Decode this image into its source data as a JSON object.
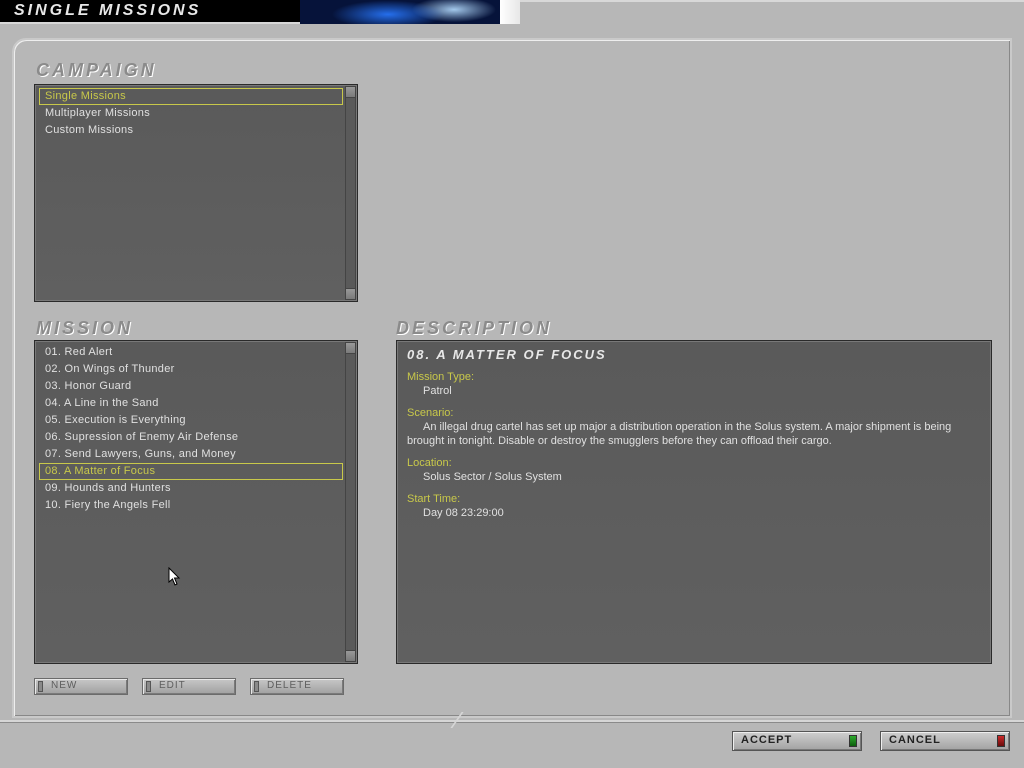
{
  "screen_title": "SINGLE MISSIONS",
  "sections": {
    "campaign": "CAMPAIGN",
    "mission": "MISSION",
    "description": "DESCRIPTION"
  },
  "campaigns": [
    {
      "label": "Single Missions",
      "selected": true
    },
    {
      "label": "Multiplayer Missions",
      "selected": false
    },
    {
      "label": "Custom Missions",
      "selected": false
    }
  ],
  "missions": [
    {
      "label": "01. Red Alert",
      "selected": false
    },
    {
      "label": "02. On Wings of Thunder",
      "selected": false
    },
    {
      "label": "03. Honor Guard",
      "selected": false
    },
    {
      "label": "04. A Line in the Sand",
      "selected": false
    },
    {
      "label": "05. Execution is Everything",
      "selected": false
    },
    {
      "label": "06. Supression of Enemy Air Defense",
      "selected": false
    },
    {
      "label": "07. Send Lawyers, Guns, and Money",
      "selected": false
    },
    {
      "label": "08. A Matter of Focus",
      "selected": true
    },
    {
      "label": "09. Hounds and Hunters",
      "selected": false
    },
    {
      "label": "10. Fiery the Angels Fell",
      "selected": false
    }
  ],
  "mission_buttons": {
    "new": "NEW",
    "edit": "EDIT",
    "delete": "DELETE"
  },
  "description": {
    "title": "08. A MATTER OF FOCUS",
    "type_label": "Mission Type:",
    "type": "Patrol",
    "scenario_label": "Scenario:",
    "scenario": "An illegal drug cartel has set up major a distribution operation in the Solus system. A major shipment is being brought in tonight. Disable or destroy the smugglers before they can offload their cargo.",
    "location_label": "Location:",
    "location": "Solus Sector / Solus System",
    "start_label": "Start Time:",
    "start": "Day 08 23:29:00"
  },
  "footer": {
    "accept": "ACCEPT",
    "cancel": "CANCEL"
  }
}
